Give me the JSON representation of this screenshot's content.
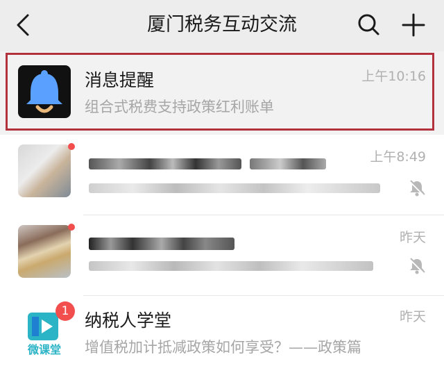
{
  "header": {
    "title": "厦门税务互动交流"
  },
  "chats": [
    {
      "name": "消息提醒",
      "preview": "组合式税费支持政策红利账单",
      "time": "上午10:16"
    },
    {
      "time": "上午8:49"
    },
    {
      "time": "昨天"
    },
    {
      "name": "纳税人学堂",
      "preview": "增值税加计抵减政策如何享受？——政策篇",
      "time": "昨天",
      "badge": "1",
      "avatar_text": "微课堂"
    }
  ],
  "icons": [
    "back-arrow-icon",
    "search-icon",
    "plus-icon",
    "bell-icon",
    "mute-icon"
  ],
  "colors": {
    "highlight": "#b3313c",
    "bell": "#5aa0ff",
    "badge": "#f24e4e",
    "play_tile": "#2bb3c6"
  }
}
